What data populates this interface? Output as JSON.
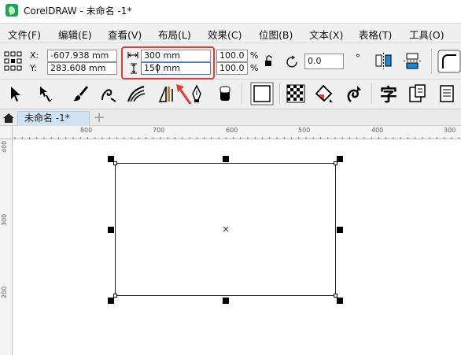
{
  "window": {
    "title": "CorelDRAW - 未命名 -1*"
  },
  "menu": [
    "文件(F)",
    "编辑(E)",
    "查看(V)",
    "布局(L)",
    "效果(C)",
    "位图(B)",
    "文本(X)",
    "表格(T)",
    "工具(O)"
  ],
  "properties": {
    "x_label": "X:",
    "x_value": "-607.938 mm",
    "y_label": "Y:",
    "y_value": "283.608 mm",
    "width_value": "300 mm",
    "height_value": "150 mm",
    "scale_x": "100.0",
    "scale_y": "100.0",
    "percent": "%",
    "rotation": "0.0"
  },
  "tab": {
    "label": "未命名 -1*",
    "add": "+"
  },
  "ruler": {
    "h_ticks": [
      "800",
      "700",
      "600",
      "500",
      "400",
      "300"
    ],
    "v_ticks": [
      "400",
      "300",
      "200"
    ]
  },
  "canvas": {
    "center_mark": "×"
  },
  "icons": {
    "text_tool": "字"
  },
  "colors": {
    "highlight": "#e53935",
    "tab_active": "#cfe1f5",
    "app_logo": "#1aa64a"
  }
}
